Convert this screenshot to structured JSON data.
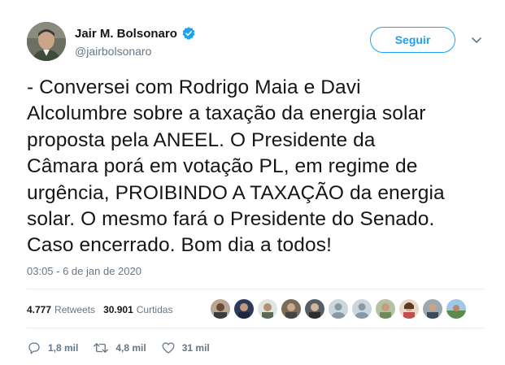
{
  "author": {
    "display_name": "Jair M. Bolsonaro",
    "handle": "@jairbolsonaro",
    "verified_icon": "verified-badge-icon"
  },
  "follow_label": "Seguir",
  "tweet_lines": [
    "- Conversei com Rodrigo Maia e Davi",
    "Alcolumbre sobre a taxação da energia solar",
    "proposta pela ANEEL. O Presidente da",
    "Câmara porá em votação PL, em regime de",
    "urgência, PROIBINDO A TAXAÇÃO da energia",
    "solar. O mesmo fará o Presidente do Senado.",
    "Caso encerrado. Bom dia a todos!"
  ],
  "timestamp": "03:05 - 6 de jan de 2020",
  "stats": {
    "retweets_count": "4.777",
    "retweets_label": "Retweets",
    "likes_count": "30.901",
    "likes_label": "Curtidas"
  },
  "actions": {
    "reply_count": "1,8 mil",
    "retweet_count": "4,8 mil",
    "like_count": "31 mil"
  },
  "colors": {
    "accent": "#1da1f2",
    "secondary_text": "#657786",
    "divider": "#e6ecf0"
  }
}
